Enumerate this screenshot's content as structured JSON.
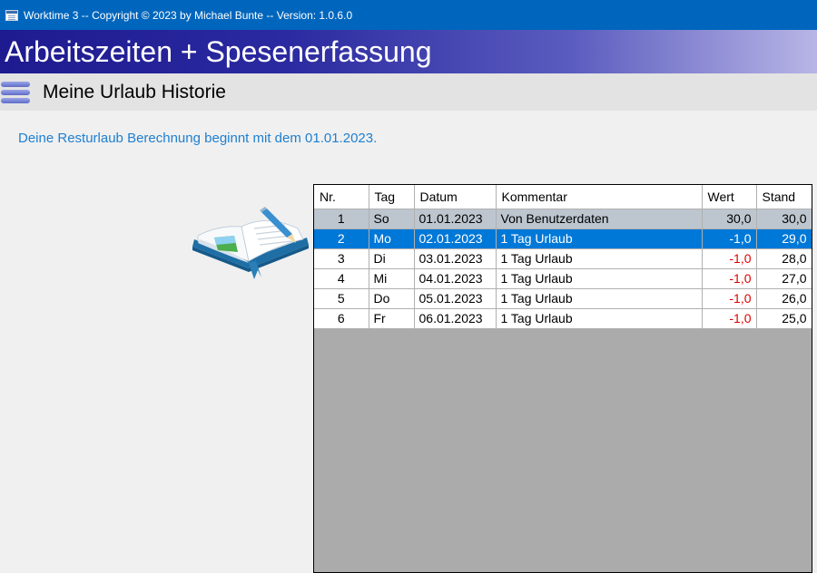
{
  "window": {
    "title": "Worktime 3 -- Copyright © 2023 by Michael Bunte -- Version: 1.0.6.0"
  },
  "banner": {
    "title": "Arbeitszeiten + Spesenerfassung"
  },
  "subheader": {
    "title": "Meine Urlaub Historie"
  },
  "info": {
    "text": "Deine Resturlaub Berechnung beginnt mit dem 01.01.2023."
  },
  "table": {
    "columns": [
      "Nr.",
      "Tag",
      "Datum",
      "Kommentar",
      "Wert",
      "Stand"
    ],
    "rows": [
      {
        "nr": "1",
        "tag": "So",
        "datum": "01.01.2023",
        "kommentar": "Von Benutzerdaten",
        "wert": "30,0",
        "stand": "30,0"
      },
      {
        "nr": "2",
        "tag": "Mo",
        "datum": "02.01.2023",
        "kommentar": "1 Tag Urlaub",
        "wert": "-1,0",
        "stand": "29,0"
      },
      {
        "nr": "3",
        "tag": "Di",
        "datum": "03.01.2023",
        "kommentar": "1 Tag Urlaub",
        "wert": "-1,0",
        "stand": "28,0"
      },
      {
        "nr": "4",
        "tag": "Mi",
        "datum": "04.01.2023",
        "kommentar": "1 Tag Urlaub",
        "wert": "-1,0",
        "stand": "27,0"
      },
      {
        "nr": "5",
        "tag": "Do",
        "datum": "05.01.2023",
        "kommentar": "1 Tag Urlaub",
        "wert": "-1,0",
        "stand": "26,0"
      },
      {
        "nr": "6",
        "tag": "Fr",
        "datum": "06.01.2023",
        "kommentar": "1 Tag Urlaub",
        "wert": "-1,0",
        "stand": "25,0"
      }
    ]
  },
  "colors": {
    "titlebar": "#0066bd",
    "banner_start": "#1e1a8f",
    "banner_end": "#b8b5e6",
    "info_text": "#1f7fcf",
    "selected_row": "#0078d7",
    "negative_value": "#e00000",
    "grid_background": "#ababab"
  },
  "icons": {
    "window": "app-window-icon",
    "menu": "hamburger-menu-icon",
    "illustration": "open-book-pencil-icon"
  }
}
